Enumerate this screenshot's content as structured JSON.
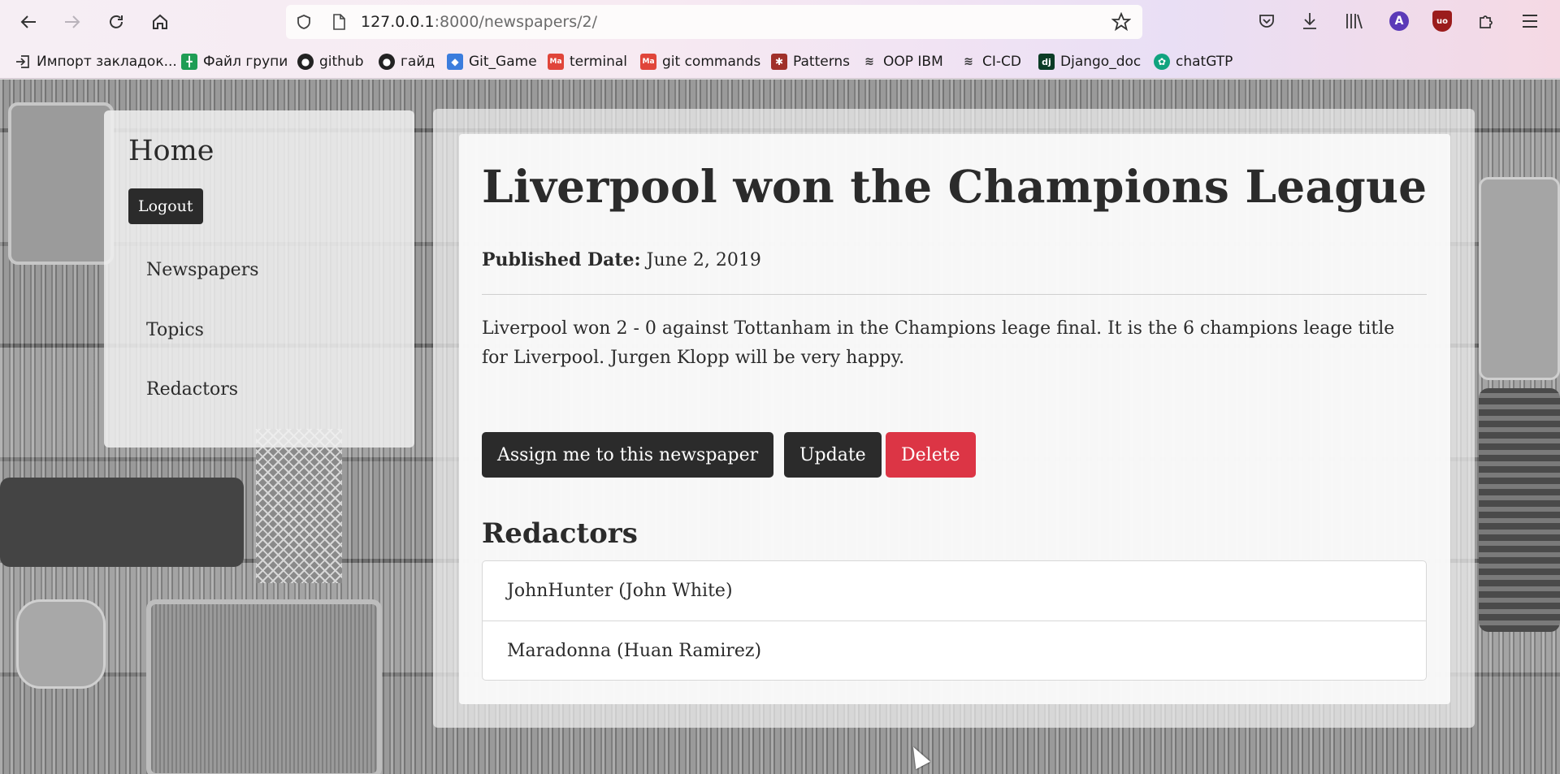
{
  "browser": {
    "url_host": "127.0.0.1",
    "url_rest": ":8000/newspapers/2/",
    "bookmarks": [
      {
        "label": "Импорт закладок...",
        "icon": "import-icon",
        "color": "#5b3a8c"
      },
      {
        "label": "Файл групи",
        "icon": "sheets-icon",
        "color": "#1f9d55"
      },
      {
        "label": "github",
        "icon": "github-icon",
        "color": "#222222"
      },
      {
        "label": "гайд",
        "icon": "github-icon",
        "color": "#222222"
      },
      {
        "label": "Git_Game",
        "icon": "game-icon",
        "color": "#3b7ddd"
      },
      {
        "label": "terminal",
        "icon": "ma-icon",
        "color": "#e0453a"
      },
      {
        "label": "git commands",
        "icon": "ma-icon",
        "color": "#e0453a"
      },
      {
        "label": "Patterns",
        "icon": "patterns-icon",
        "color": "#a0302a"
      },
      {
        "label": "OOP IBM",
        "icon": "ibm-icon",
        "color": "#333333"
      },
      {
        "label": "CI-CD",
        "icon": "ibm-icon",
        "color": "#333333"
      },
      {
        "label": "Django_doc",
        "icon": "django-icon",
        "color": "#0c3c26"
      },
      {
        "label": "chatGTP",
        "icon": "chatgpt-icon",
        "color": "#10a37f"
      }
    ]
  },
  "sidebar": {
    "home": "Home",
    "logout": "Logout",
    "links": [
      "Newspapers",
      "Topics",
      "Redactors"
    ]
  },
  "article": {
    "title": "Liverpool won the Champions League",
    "published_label": "Published Date:",
    "published_date": "June 2, 2019",
    "content": "Liverpool won 2 - 0 against Tottanham in the Champions leage final. It is the 6 champions leage title for Liverpool. Jurgen Klopp will be very happy.",
    "buttons": {
      "assign": "Assign me to this newspaper",
      "update": "Update",
      "delete": "Delete"
    },
    "redactors_heading": "Redactors",
    "redactors": [
      "JohnHunter (John White)",
      "Maradonna (Huan Ramirez)"
    ]
  },
  "colors": {
    "dark_button": "#2b2b2b",
    "delete_button": "#dc3545"
  }
}
